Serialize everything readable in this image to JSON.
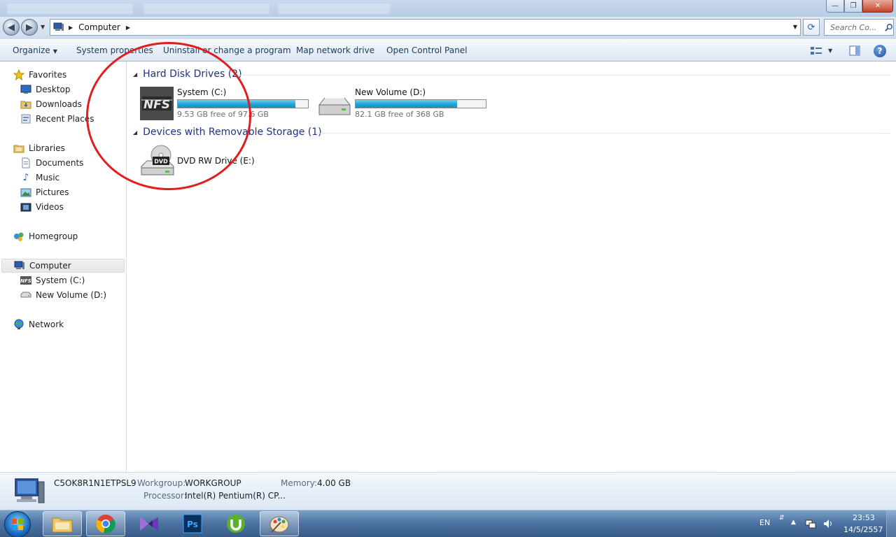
{
  "window": {
    "controls": {
      "minimize": "—",
      "maximize": "❐",
      "close": "✕"
    }
  },
  "address": {
    "location": "Computer",
    "search_placeholder": "Search Co..."
  },
  "commands": {
    "organize": "Organize",
    "system_properties": "System properties",
    "uninstall": "Uninstall or change a program",
    "map_drive": "Map network drive",
    "control_panel": "Open Control Panel",
    "help": "?"
  },
  "nav": {
    "favorites": "Favorites",
    "desktop": "Desktop",
    "downloads": "Downloads",
    "recent": "Recent Places",
    "libraries": "Libraries",
    "documents": "Documents",
    "music": "Music",
    "pictures": "Pictures",
    "videos": "Videos",
    "homegroup": "Homegroup",
    "computer": "Computer",
    "system_c": "System (C:)",
    "volume_d": "New Volume (D:)",
    "network": "Network"
  },
  "content": {
    "hdd_header": "Hard Disk Drives (2)",
    "removable_header": "Devices with Removable Storage (1)",
    "drives": [
      {
        "name": "System (C:)",
        "free": "9.53 GB free of 97.6 GB",
        "used_fraction": 0.902
      },
      {
        "name": "New Volume (D:)",
        "free": "82.1 GB free of 368 GB",
        "used_fraction": 0.777
      }
    ],
    "dvd": {
      "name": "DVD RW Drive (E:)",
      "badge": "DVD"
    }
  },
  "details": {
    "computer_name": "C5OK8R1N1ETPSL9",
    "workgroup_label": "Workgroup:",
    "workgroup": "WORKGROUP",
    "memory_label": "Memory:",
    "memory": "4.00 GB",
    "processor_label": "Processor:",
    "processor": "Intel(R) Pentium(R) CP..."
  },
  "taskbar": {
    "language": "EN",
    "time": "23:53",
    "date": "14/5/2557"
  },
  "colors": {
    "accent_link": "#1e3287",
    "bar_fill": "#27a6d6",
    "annotation": "#e01e1e"
  }
}
